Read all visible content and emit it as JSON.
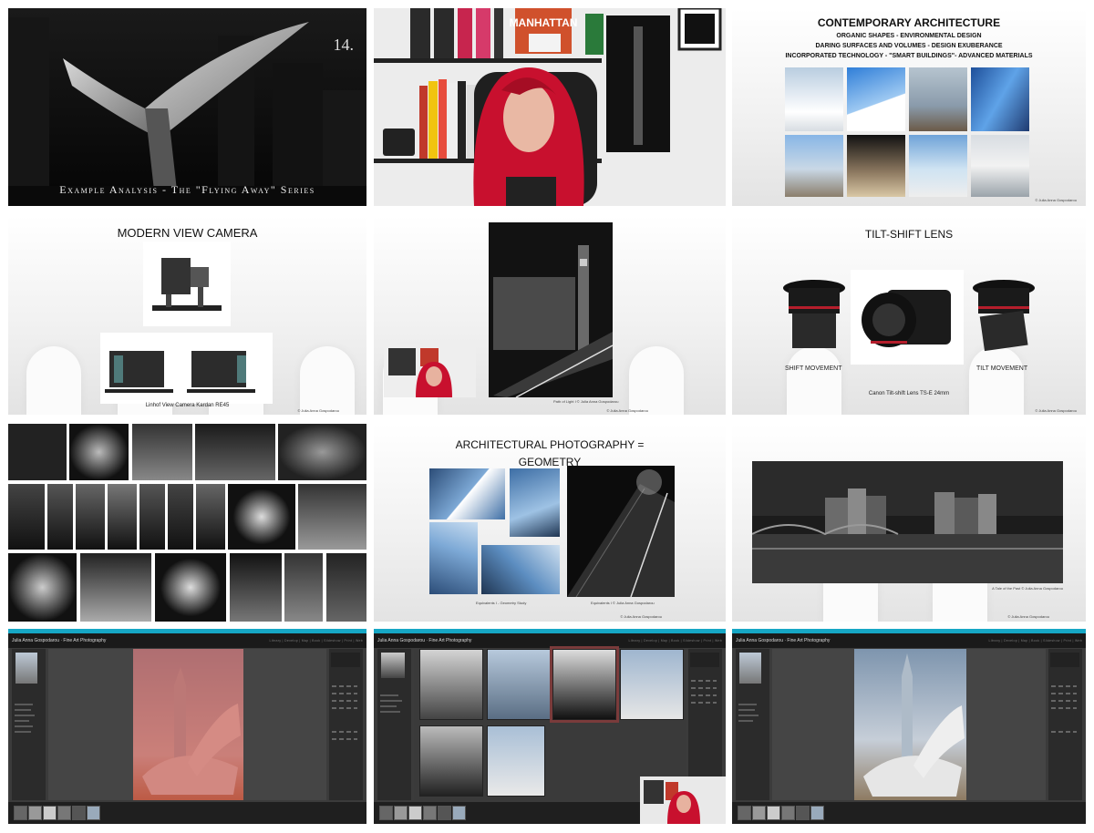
{
  "slides": {
    "intro": {
      "number": "14.",
      "caption": "Example Analysis - The \"Flying Away\" Series"
    },
    "contemporary": {
      "title": "CONTEMPORARY ARCHITECTURE",
      "lines": [
        "ORGANIC SHAPES - ENVIRONMENTAL DESIGN",
        "DARING SURFACES AND VOLUMES - DESIGN EXUBERANCE",
        "INCORPORATED TECHNOLOGY - \"SMART BUILDINGS\"- ADVANCED MATERIALS"
      ],
      "copyright": "© Julia Anna Gospodarou"
    },
    "view_camera": {
      "title": "MODERN VIEW CAMERA",
      "caption": "Linhof View Camera Kardan RE45",
      "copyright": "© Julia Anna Gospodarou"
    },
    "path_of_light": {
      "caption": "Path of Light I © Julia Anna Gospodarou",
      "copyright": "© Julia Anna Gospodarou"
    },
    "tilt_shift": {
      "title": "TILT-SHIFT LENS",
      "label_left": "SHIFT MOVEMENT",
      "label_right": "TILT MOVEMENT",
      "caption": "Canon Tilt-shift Lens TS-E 24mm",
      "copyright": "© Julia Anna Gospodarou"
    },
    "geometry": {
      "title": "ARCHITECTURAL PHOTOGRAPHY = GEOMETRY",
      "caption_left": "Equivalents I - Geometry Study",
      "caption_right": "Equivalents I © Julia Anna Gospodarou",
      "copyright": "© Julia Anna Gospodarou"
    },
    "amsterdam": {
      "caption": "A Tale of the Past © Julia Anna Gospodarou",
      "copyright": "© Julia Anna Gospodarou"
    }
  },
  "lightroom": {
    "brand": "Julia Anna Gospodarou · Fine Art Photography",
    "modules": "Library  |  Develop  |  Map  |  Book  |  Slideshow  |  Print  |  Web"
  },
  "colors": {
    "accent": "#16a7c5",
    "hair": "#c8102e",
    "overlay": "#c0392b"
  }
}
